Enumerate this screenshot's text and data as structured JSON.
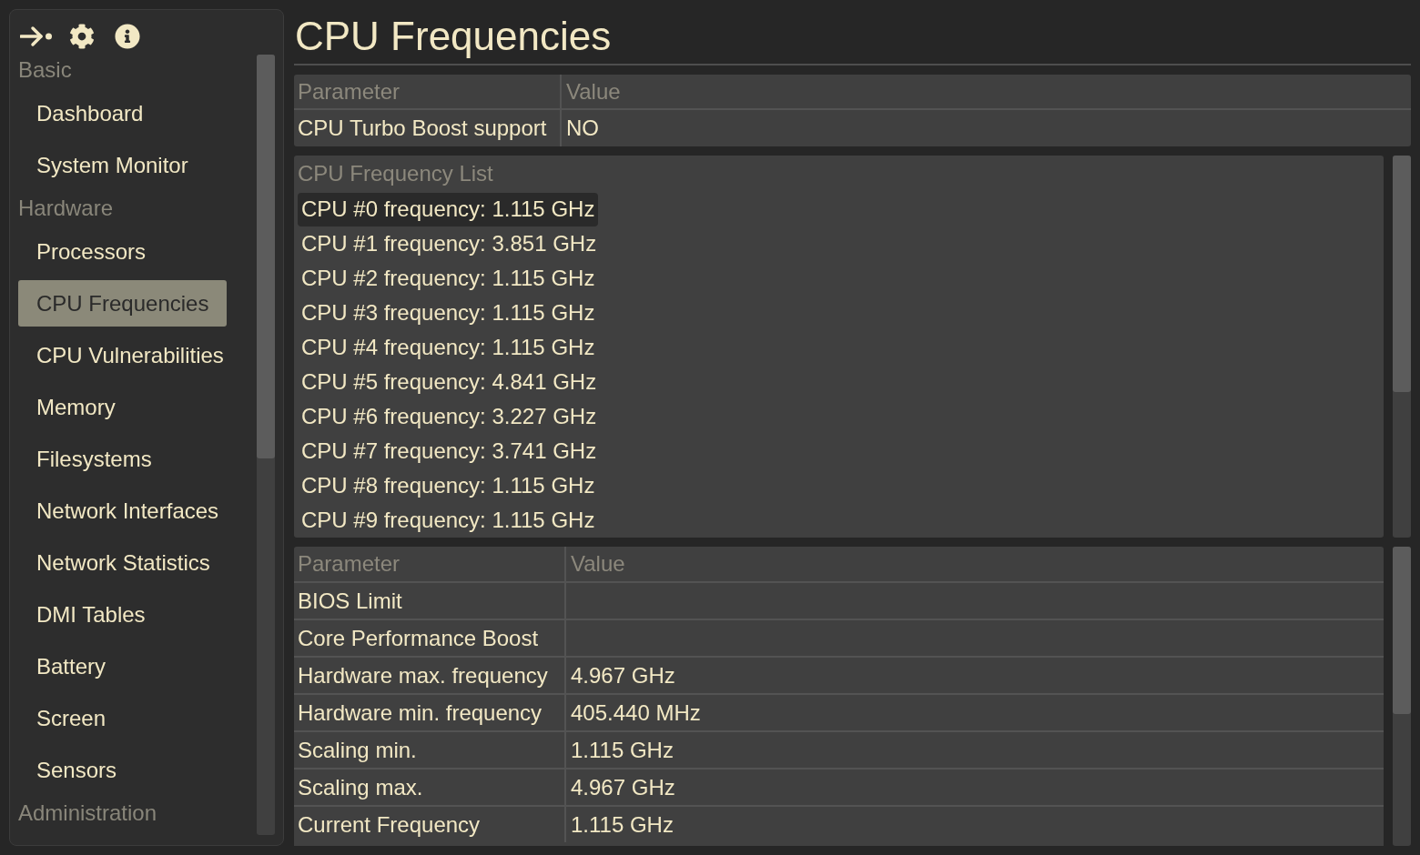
{
  "sidebar": {
    "groups": [
      {
        "label": "Basic",
        "items": [
          {
            "label": "Dashboard",
            "selected": false
          },
          {
            "label": "System Monitor",
            "selected": false
          }
        ]
      },
      {
        "label": "Hardware",
        "items": [
          {
            "label": "Processors",
            "selected": false
          },
          {
            "label": "CPU Frequencies",
            "selected": true
          },
          {
            "label": "CPU Vulnerabilities",
            "selected": false
          },
          {
            "label": "Memory",
            "selected": false
          },
          {
            "label": "Filesystems",
            "selected": false
          },
          {
            "label": "Network Interfaces",
            "selected": false
          },
          {
            "label": "Network Statistics",
            "selected": false
          },
          {
            "label": "DMI Tables",
            "selected": false
          },
          {
            "label": "Battery",
            "selected": false
          },
          {
            "label": "Screen",
            "selected": false
          },
          {
            "label": "Sensors",
            "selected": false
          }
        ]
      },
      {
        "label": "Administration"
      }
    ]
  },
  "page_title": "CPU Frequencies",
  "summary_table": {
    "columns": [
      "Parameter",
      "Value"
    ],
    "rows": [
      {
        "parameter": "CPU Turbo Boost support",
        "value": "NO"
      }
    ]
  },
  "frequency_list": {
    "title": "CPU Frequency List",
    "items": [
      {
        "label": "CPU #0 frequency: 1.115 GHz",
        "selected": true
      },
      {
        "label": "CPU #1 frequency: 3.851 GHz",
        "selected": false
      },
      {
        "label": "CPU #2 frequency: 1.115 GHz",
        "selected": false
      },
      {
        "label": "CPU #3 frequency: 1.115 GHz",
        "selected": false
      },
      {
        "label": "CPU #4 frequency: 1.115 GHz",
        "selected": false
      },
      {
        "label": "CPU #5 frequency: 4.841 GHz",
        "selected": false
      },
      {
        "label": "CPU #6 frequency: 3.227 GHz",
        "selected": false
      },
      {
        "label": "CPU #7 frequency: 3.741 GHz",
        "selected": false
      },
      {
        "label": "CPU #8 frequency: 1.115 GHz",
        "selected": false
      },
      {
        "label": "CPU #9 frequency: 1.115 GHz",
        "selected": false
      }
    ]
  },
  "details_table": {
    "columns": [
      "Parameter",
      "Value"
    ],
    "rows": [
      {
        "parameter": "BIOS Limit"
      },
      {
        "parameter": "Core Performance Boost"
      },
      {
        "parameter": "Hardware max. frequency",
        "value": "4.967 GHz"
      },
      {
        "parameter": "Hardware min. frequency",
        "value": "405.440 MHz"
      },
      {
        "parameter": "Scaling min.",
        "value": "1.115 GHz"
      },
      {
        "parameter": "Scaling max.",
        "value": "4.967 GHz"
      },
      {
        "parameter": "Current Frequency",
        "value": "1.115 GHz"
      }
    ]
  }
}
